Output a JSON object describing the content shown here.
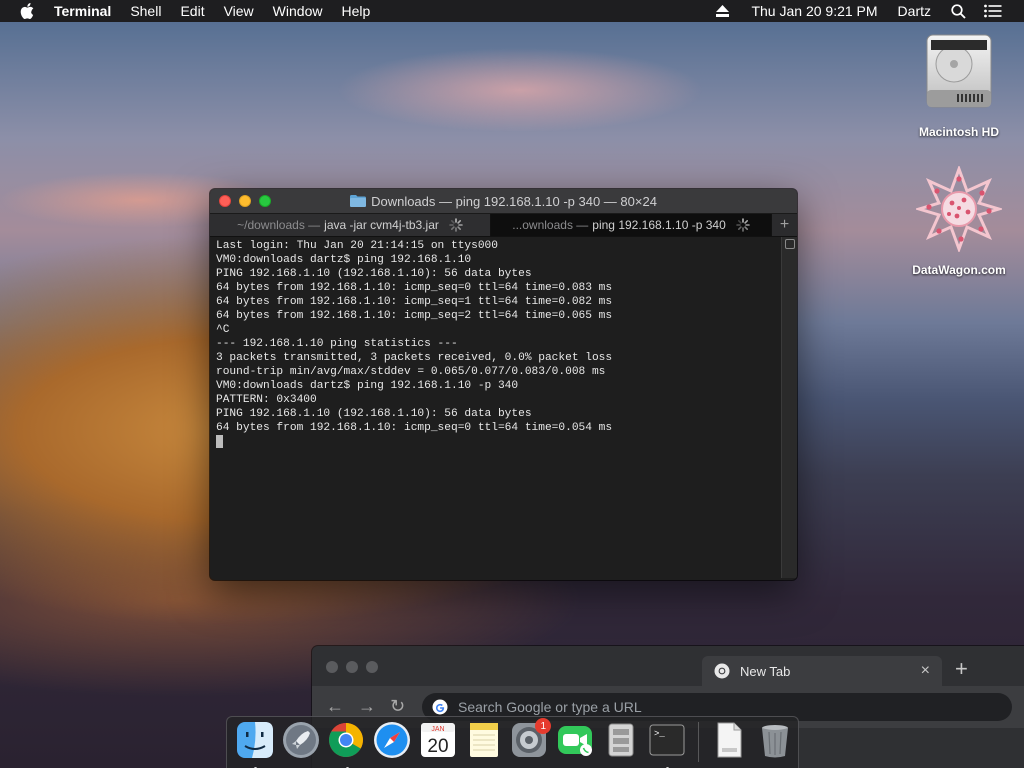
{
  "menubar": {
    "app_name": "Terminal",
    "menus": [
      "Shell",
      "Edit",
      "View",
      "Window",
      "Help"
    ],
    "clock": "Thu Jan 20  9:21 PM",
    "user": "Dartz"
  },
  "desktop": {
    "icons": [
      {
        "label": "Macintosh HD",
        "icon": "hard-drive-icon"
      },
      {
        "label": "DataWagon.com",
        "icon": "datawagon-logo-icon"
      }
    ]
  },
  "terminal": {
    "title": "Downloads — ping 192.168.1.10 -p 340 — 80×24",
    "tabs": [
      {
        "dim": "~/downloads —",
        "label": "java -jar cvm4j-tb3.jar"
      },
      {
        "dim": "...ownloads —",
        "label": "ping 192.168.1.10 -p 340"
      }
    ],
    "new_tab": "+",
    "lines": [
      "Last login: Thu Jan 20 21:14:15 on ttys000",
      "VM0:downloads dartz$ ping 192.168.1.10",
      "PING 192.168.1.10 (192.168.1.10): 56 data bytes",
      "64 bytes from 192.168.1.10: icmp_seq=0 ttl=64 time=0.083 ms",
      "64 bytes from 192.168.1.10: icmp_seq=1 ttl=64 time=0.082 ms",
      "64 bytes from 192.168.1.10: icmp_seq=2 ttl=64 time=0.065 ms",
      "^C",
      "--- 192.168.1.10 ping statistics ---",
      "3 packets transmitted, 3 packets received, 0.0% packet loss",
      "round-trip min/avg/max/stddev = 0.065/0.077/0.083/0.008 ms",
      "VM0:downloads dartz$ ping 192.168.1.10 -p 340",
      "PATTERN: 0x3400",
      "PING 192.168.1.10 (192.168.1.10): 56 data bytes",
      "64 bytes from 192.168.1.10: icmp_seq=0 ttl=64 time=0.054 ms"
    ]
  },
  "chrome": {
    "tab_title": "New Tab",
    "close": "×",
    "new_tab": "+",
    "back": "←",
    "forward": "→",
    "reload": "↻",
    "omnibox_placeholder": "Search Google or type a URL"
  },
  "dock": {
    "apps": [
      "finder",
      "launchpad",
      "chrome",
      "safari",
      "calendar",
      "notes",
      "system-preferences",
      "facetime",
      "migration-assistant",
      "terminal"
    ],
    "calendar": {
      "month": "JAN",
      "day": "20"
    },
    "system_preferences_badge": "1",
    "stacks": [
      "xml-document",
      "trash"
    ]
  }
}
